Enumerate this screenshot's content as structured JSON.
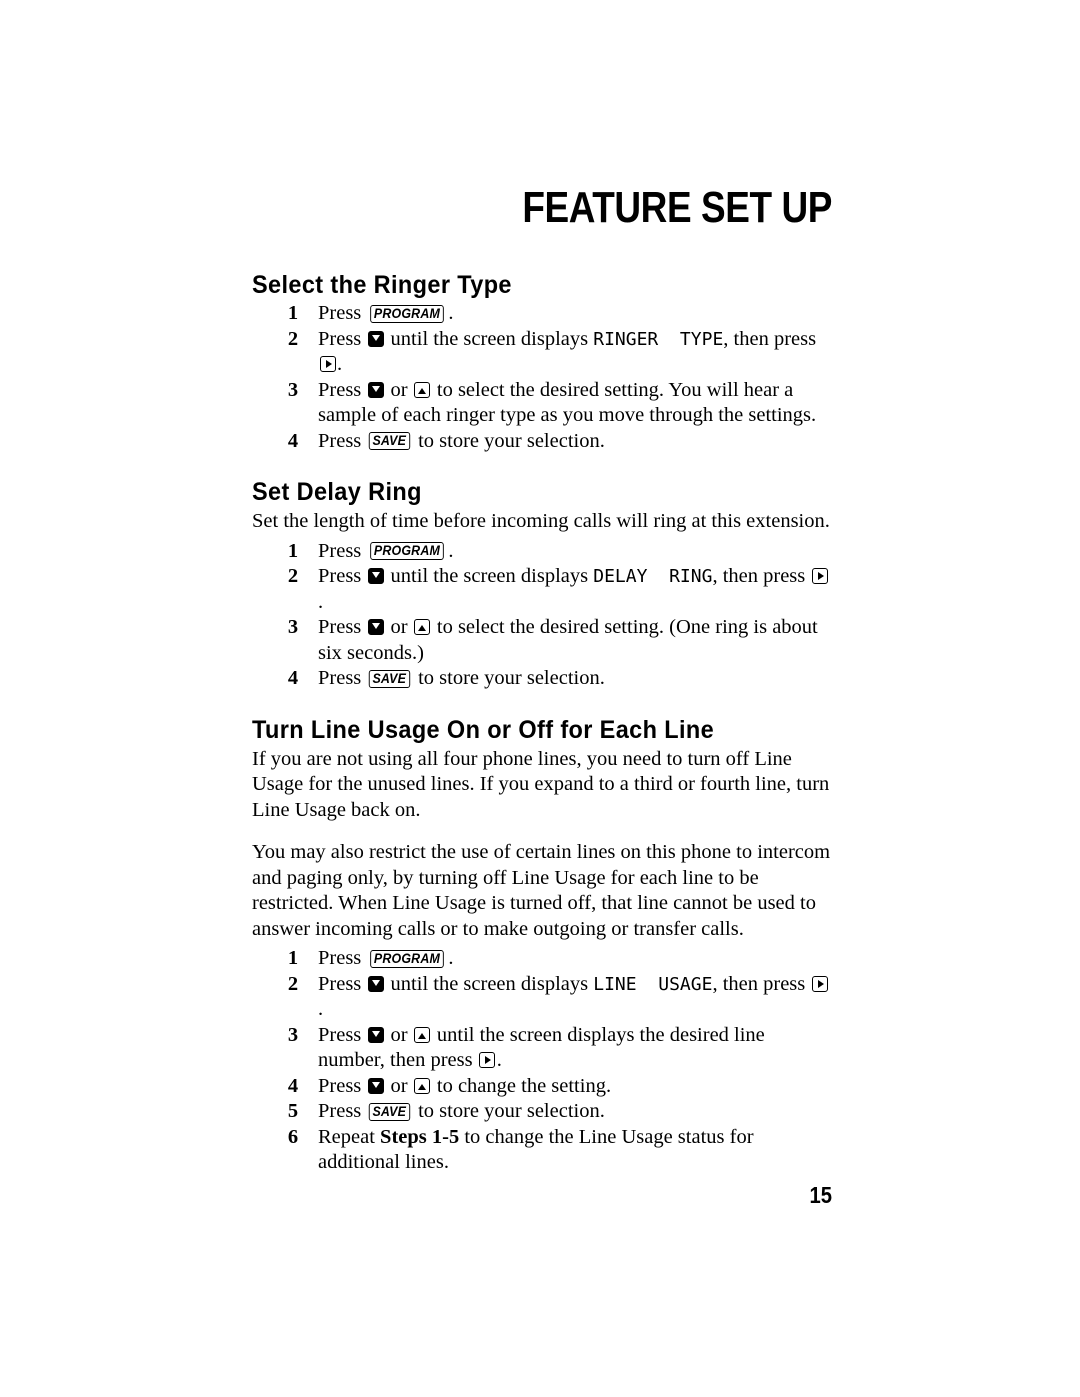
{
  "document": {
    "chapter_title": "FEATURE SET UP",
    "page_number": "15"
  },
  "keys": {
    "program": "PROGRAM",
    "save": "SAVE"
  },
  "sections": [
    {
      "heading": "Select the Ringer Type",
      "steps": [
        {
          "num": "1",
          "parts": [
            {
              "t": "text",
              "v": "Press "
            },
            {
              "t": "key",
              "v": "PROGRAM"
            },
            {
              "t": "text",
              "v": "."
            }
          ]
        },
        {
          "num": "2",
          "parts": [
            {
              "t": "text",
              "v": "Press "
            },
            {
              "t": "akey",
              "v": "down"
            },
            {
              "t": "text",
              "v": " until the screen displays "
            },
            {
              "t": "lcd",
              "v": "RINGER  TYPE"
            },
            {
              "t": "text",
              "v": ", then press "
            },
            {
              "t": "akey",
              "v": "right"
            },
            {
              "t": "text",
              "v": "."
            }
          ]
        },
        {
          "num": "3",
          "parts": [
            {
              "t": "text",
              "v": "Press "
            },
            {
              "t": "akey",
              "v": "down"
            },
            {
              "t": "text",
              "v": " or "
            },
            {
              "t": "akey",
              "v": "up"
            },
            {
              "t": "text",
              "v": " to select the desired setting. You will hear a sample of each ringer type as you move through the settings."
            }
          ]
        },
        {
          "num": "4",
          "parts": [
            {
              "t": "text",
              "v": "Press "
            },
            {
              "t": "key",
              "v": "SAVE"
            },
            {
              "t": "text",
              "v": " to store your selection."
            }
          ]
        }
      ]
    },
    {
      "heading": "Set Delay Ring",
      "paragraphs": [
        "Set the length of time before incoming calls will ring at this extension."
      ],
      "steps": [
        {
          "num": "1",
          "parts": [
            {
              "t": "text",
              "v": "Press "
            },
            {
              "t": "key",
              "v": "PROGRAM"
            },
            {
              "t": "text",
              "v": "."
            }
          ]
        },
        {
          "num": "2",
          "parts": [
            {
              "t": "text",
              "v": "Press "
            },
            {
              "t": "akey",
              "v": "down"
            },
            {
              "t": "text",
              "v": " until the screen displays "
            },
            {
              "t": "lcd",
              "v": "DELAY  RING"
            },
            {
              "t": "text",
              "v": ", then press "
            },
            {
              "t": "akey",
              "v": "right"
            },
            {
              "t": "text",
              "v": "."
            }
          ]
        },
        {
          "num": "3",
          "parts": [
            {
              "t": "text",
              "v": "Press "
            },
            {
              "t": "akey",
              "v": "down"
            },
            {
              "t": "text",
              "v": " or "
            },
            {
              "t": "akey",
              "v": "up"
            },
            {
              "t": "text",
              "v": " to select the desired setting.  (One ring is about six seconds.)"
            }
          ]
        },
        {
          "num": "4",
          "parts": [
            {
              "t": "text",
              "v": "Press "
            },
            {
              "t": "key",
              "v": "SAVE"
            },
            {
              "t": "text",
              "v": " to store your selection."
            }
          ]
        }
      ]
    },
    {
      "heading": "Turn Line Usage On or Off for Each Line",
      "paragraphs": [
        "If you are not using all four phone lines, you need to turn off Line Usage for the unused lines.  If you expand to a third or fourth line, turn Line Usage back on.",
        "You may also restrict the use of certain lines on this phone to intercom and paging only, by turning off Line Usage for each line to be restricted. When Line Usage is turned off, that line cannot be used to answer incoming calls or to make outgoing or transfer calls."
      ],
      "steps": [
        {
          "num": "1",
          "parts": [
            {
              "t": "text",
              "v": "Press "
            },
            {
              "t": "key",
              "v": "PROGRAM"
            },
            {
              "t": "text",
              "v": "."
            }
          ]
        },
        {
          "num": "2",
          "parts": [
            {
              "t": "text",
              "v": "Press "
            },
            {
              "t": "akey",
              "v": "down"
            },
            {
              "t": "text",
              "v": " until the screen displays "
            },
            {
              "t": "lcd",
              "v": "LINE  USAGE"
            },
            {
              "t": "text",
              "v": ", then press "
            },
            {
              "t": "akey",
              "v": "right"
            },
            {
              "t": "text",
              "v": "."
            }
          ]
        },
        {
          "num": "3",
          "parts": [
            {
              "t": "text",
              "v": "Press "
            },
            {
              "t": "akey",
              "v": "down"
            },
            {
              "t": "text",
              "v": " or "
            },
            {
              "t": "akey",
              "v": "up"
            },
            {
              "t": "text",
              "v": " until the screen displays the desired line number, then press "
            },
            {
              "t": "akey",
              "v": "right"
            },
            {
              "t": "text",
              "v": "."
            }
          ]
        },
        {
          "num": "4",
          "parts": [
            {
              "t": "text",
              "v": "Press "
            },
            {
              "t": "akey",
              "v": "down"
            },
            {
              "t": "text",
              "v": " or "
            },
            {
              "t": "akey",
              "v": "up"
            },
            {
              "t": "text",
              "v": " to change the setting."
            }
          ]
        },
        {
          "num": "5",
          "parts": [
            {
              "t": "text",
              "v": "Press "
            },
            {
              "t": "key",
              "v": "SAVE"
            },
            {
              "t": "text",
              "v": " to store your selection."
            }
          ]
        },
        {
          "num": "6",
          "parts": [
            {
              "t": "text",
              "v": "Repeat "
            },
            {
              "t": "bold",
              "v": "Steps 1-5"
            },
            {
              "t": "text",
              "v": " to change the Line Usage status for additional lines."
            }
          ]
        }
      ]
    }
  ]
}
